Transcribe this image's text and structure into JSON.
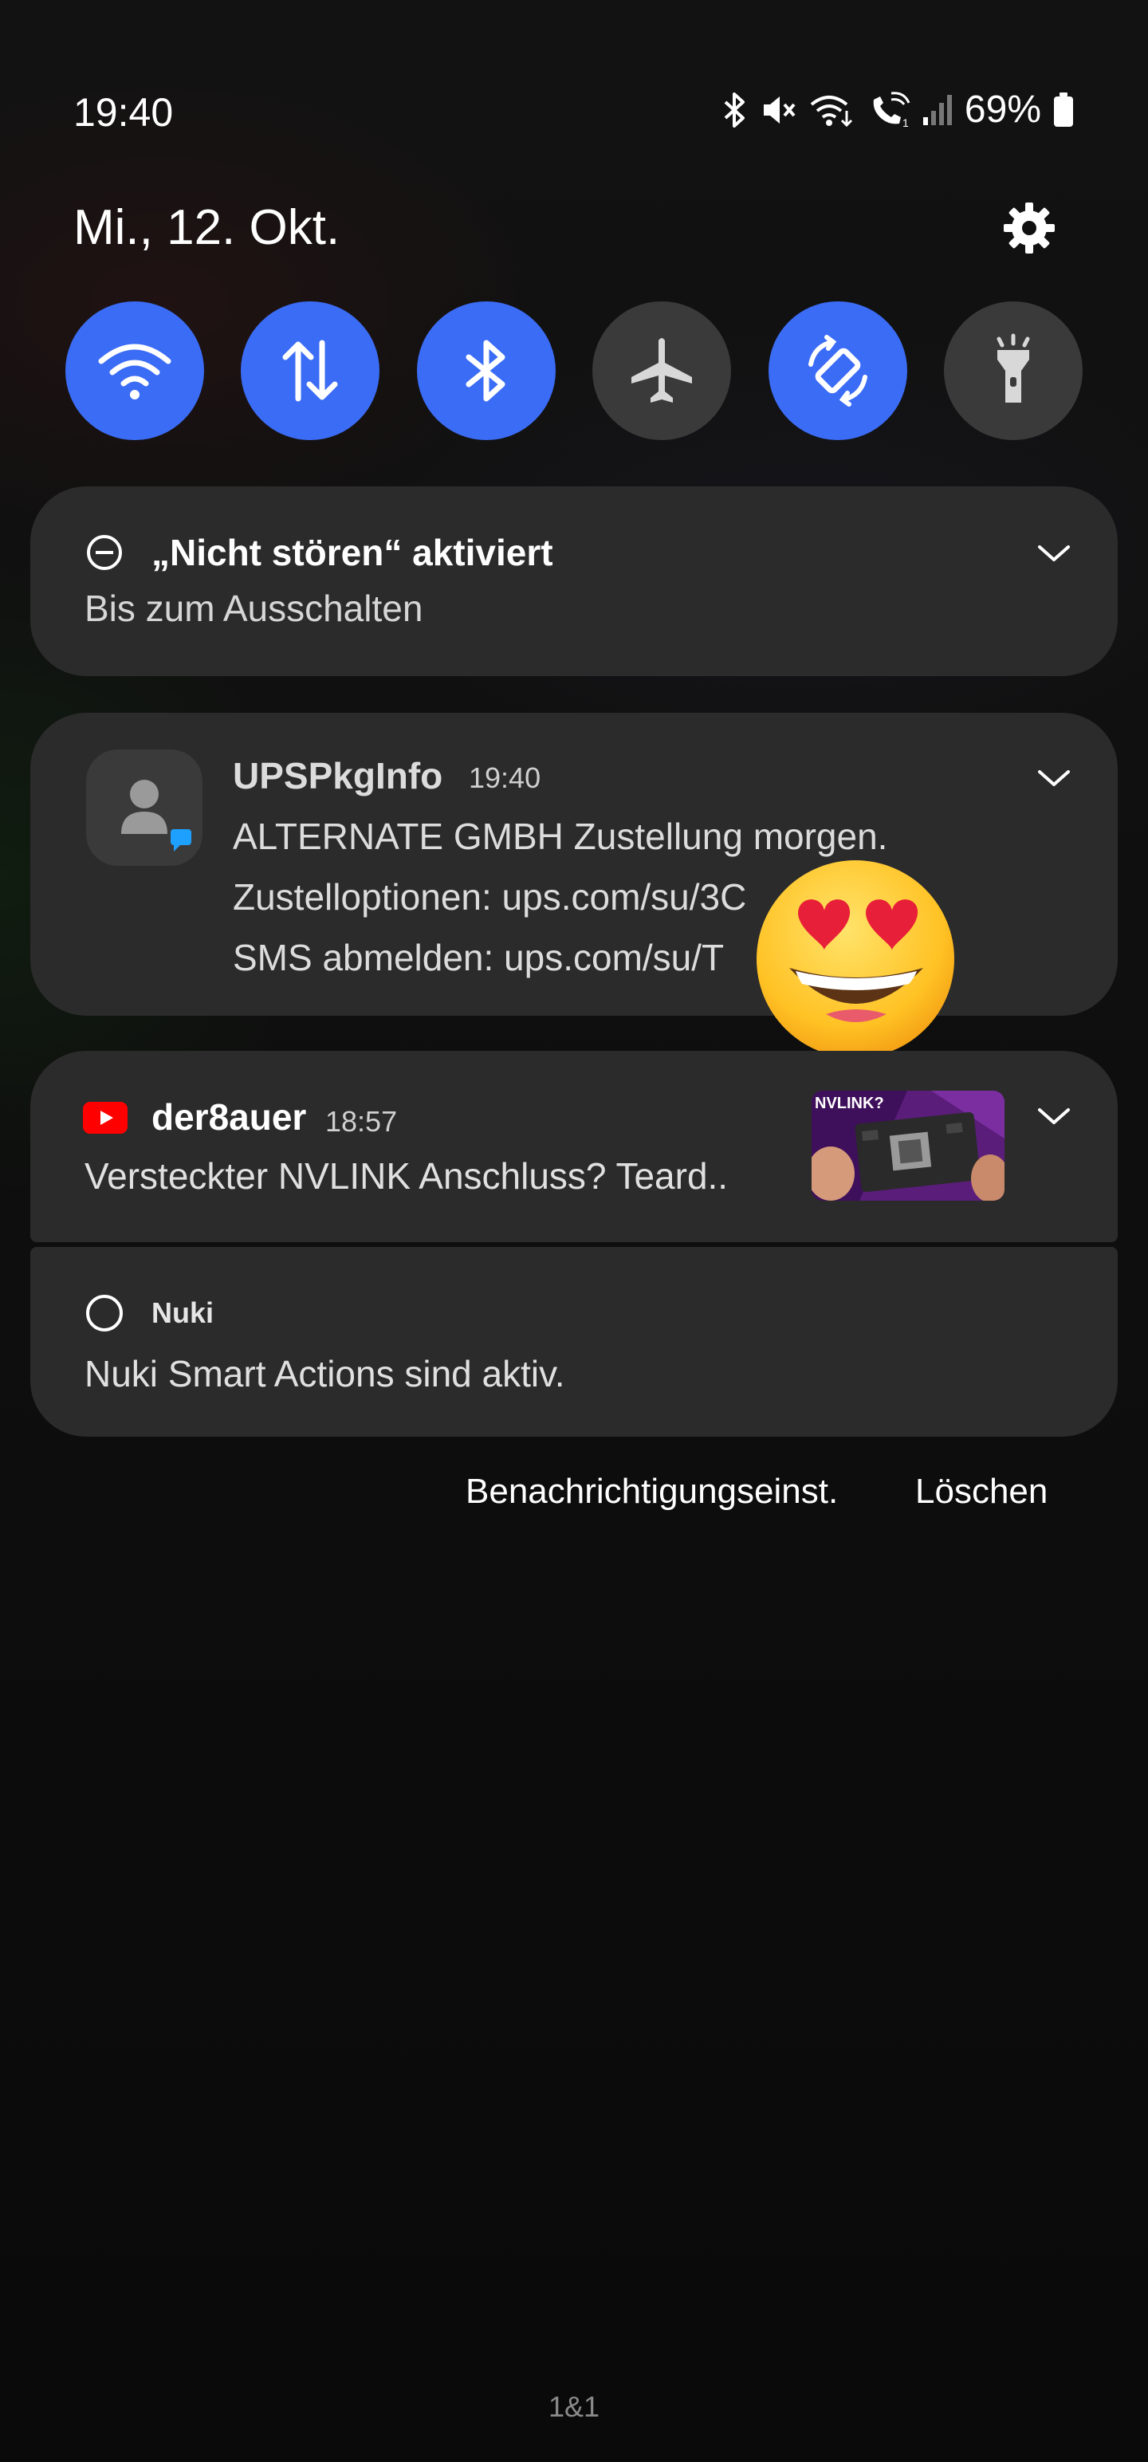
{
  "status_bar": {
    "time": "19:40",
    "battery_percent": "69%",
    "icons": [
      "bluetooth-icon",
      "mute-icon",
      "wifi-calling-icon",
      "volte-call-icon",
      "signal-icon",
      "battery-icon"
    ]
  },
  "header": {
    "date": "Mi., 12. Okt."
  },
  "quick_toggles": [
    {
      "name": "wifi-icon",
      "state": "on"
    },
    {
      "name": "mobile-data-icon",
      "state": "on"
    },
    {
      "name": "bluetooth-icon",
      "state": "on"
    },
    {
      "name": "airplane-icon",
      "state": "off"
    },
    {
      "name": "auto-rotate-icon",
      "state": "on"
    },
    {
      "name": "flashlight-icon",
      "state": "off"
    }
  ],
  "notifications": {
    "dnd": {
      "title": "„Nicht stören“ aktiviert",
      "subtitle": "Bis zum Ausschalten"
    },
    "ups": {
      "app": "UPSPkgInfo",
      "time": "19:40",
      "line1": "ALTERNATE GMBH Zustellung morgen.",
      "line2": "Zustelloptionen: ups.com/su/3C",
      "line3": "SMS abmelden: ups.com/su/T"
    },
    "youtube": {
      "app": "der8auer",
      "time": "18:57",
      "text": "Versteckter NVLINK Anschluss? Teard..",
      "thumbnail_text": "NVLINK?"
    },
    "nuki": {
      "app": "Nuki",
      "text": "Nuki Smart Actions sind aktiv."
    }
  },
  "actions": {
    "settings_label": "Benachrichtigungseinst.",
    "clear_label": "Löschen"
  },
  "carrier": "1&1",
  "colors": {
    "toggle_on": "#3b6cf5",
    "toggle_off": "#3a3a3a",
    "card_bg": "#2b2b2b",
    "youtube_red": "#ff0000"
  }
}
